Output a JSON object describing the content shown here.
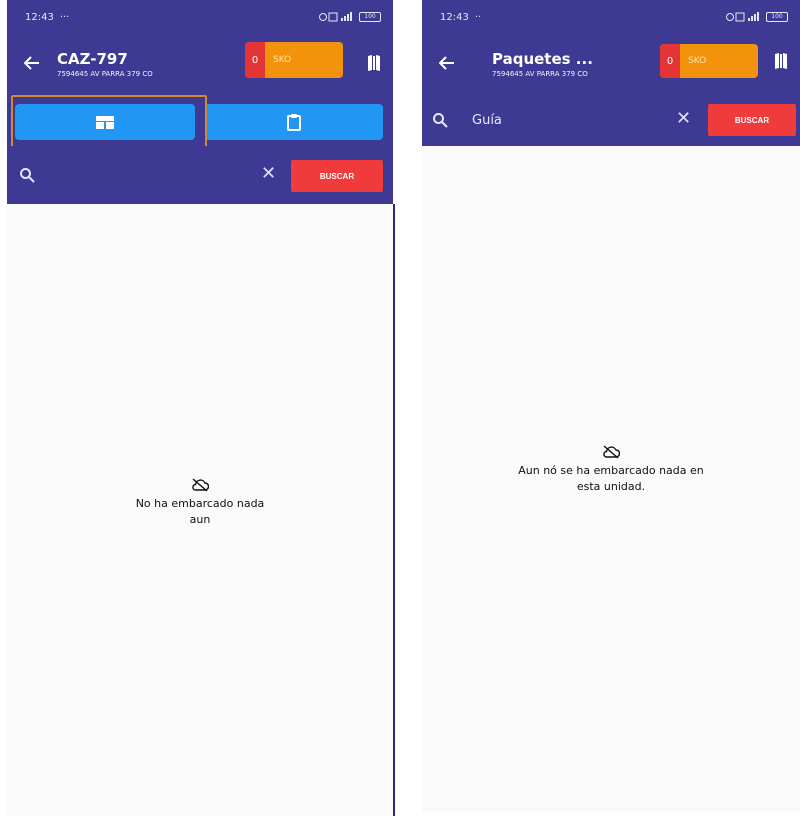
{
  "left": {
    "status": {
      "time": "12:43",
      "extra": "···",
      "battery": "100"
    },
    "appbar": {
      "title": "CAZ-797",
      "subtitle": "7594645 AV PARRA 379 CO"
    },
    "counter": {
      "count": "0",
      "label": "SKO"
    },
    "search": {
      "placeholder": "",
      "button_label": "BUSCAR"
    },
    "empty_message": "No ha embarcado nada aun"
  },
  "right": {
    "status": {
      "time": "12:43",
      "extra": "··",
      "battery": "100"
    },
    "appbar": {
      "title": "Paquetes ...",
      "subtitle": "7594645 AV PARRA 379 CO"
    },
    "counter": {
      "count": "0",
      "label": "SKO"
    },
    "search": {
      "value": "Guía",
      "button_label": "BUSCAR"
    },
    "empty_message": "Aun nó se ha embarcado nada en esta unidad."
  },
  "colors": {
    "primary": "#3e3a94",
    "tab_blue": "#2196f3",
    "button_red": "#ef3b3b",
    "counter_orange": "#f2930b",
    "counter_red": "#e33535",
    "highlight": "#d08a2e"
  },
  "icons": [
    "back-arrow-icon",
    "map-icon",
    "table-view-icon",
    "clipboard-icon",
    "search-icon",
    "clear-icon",
    "cloud-off-icon"
  ]
}
